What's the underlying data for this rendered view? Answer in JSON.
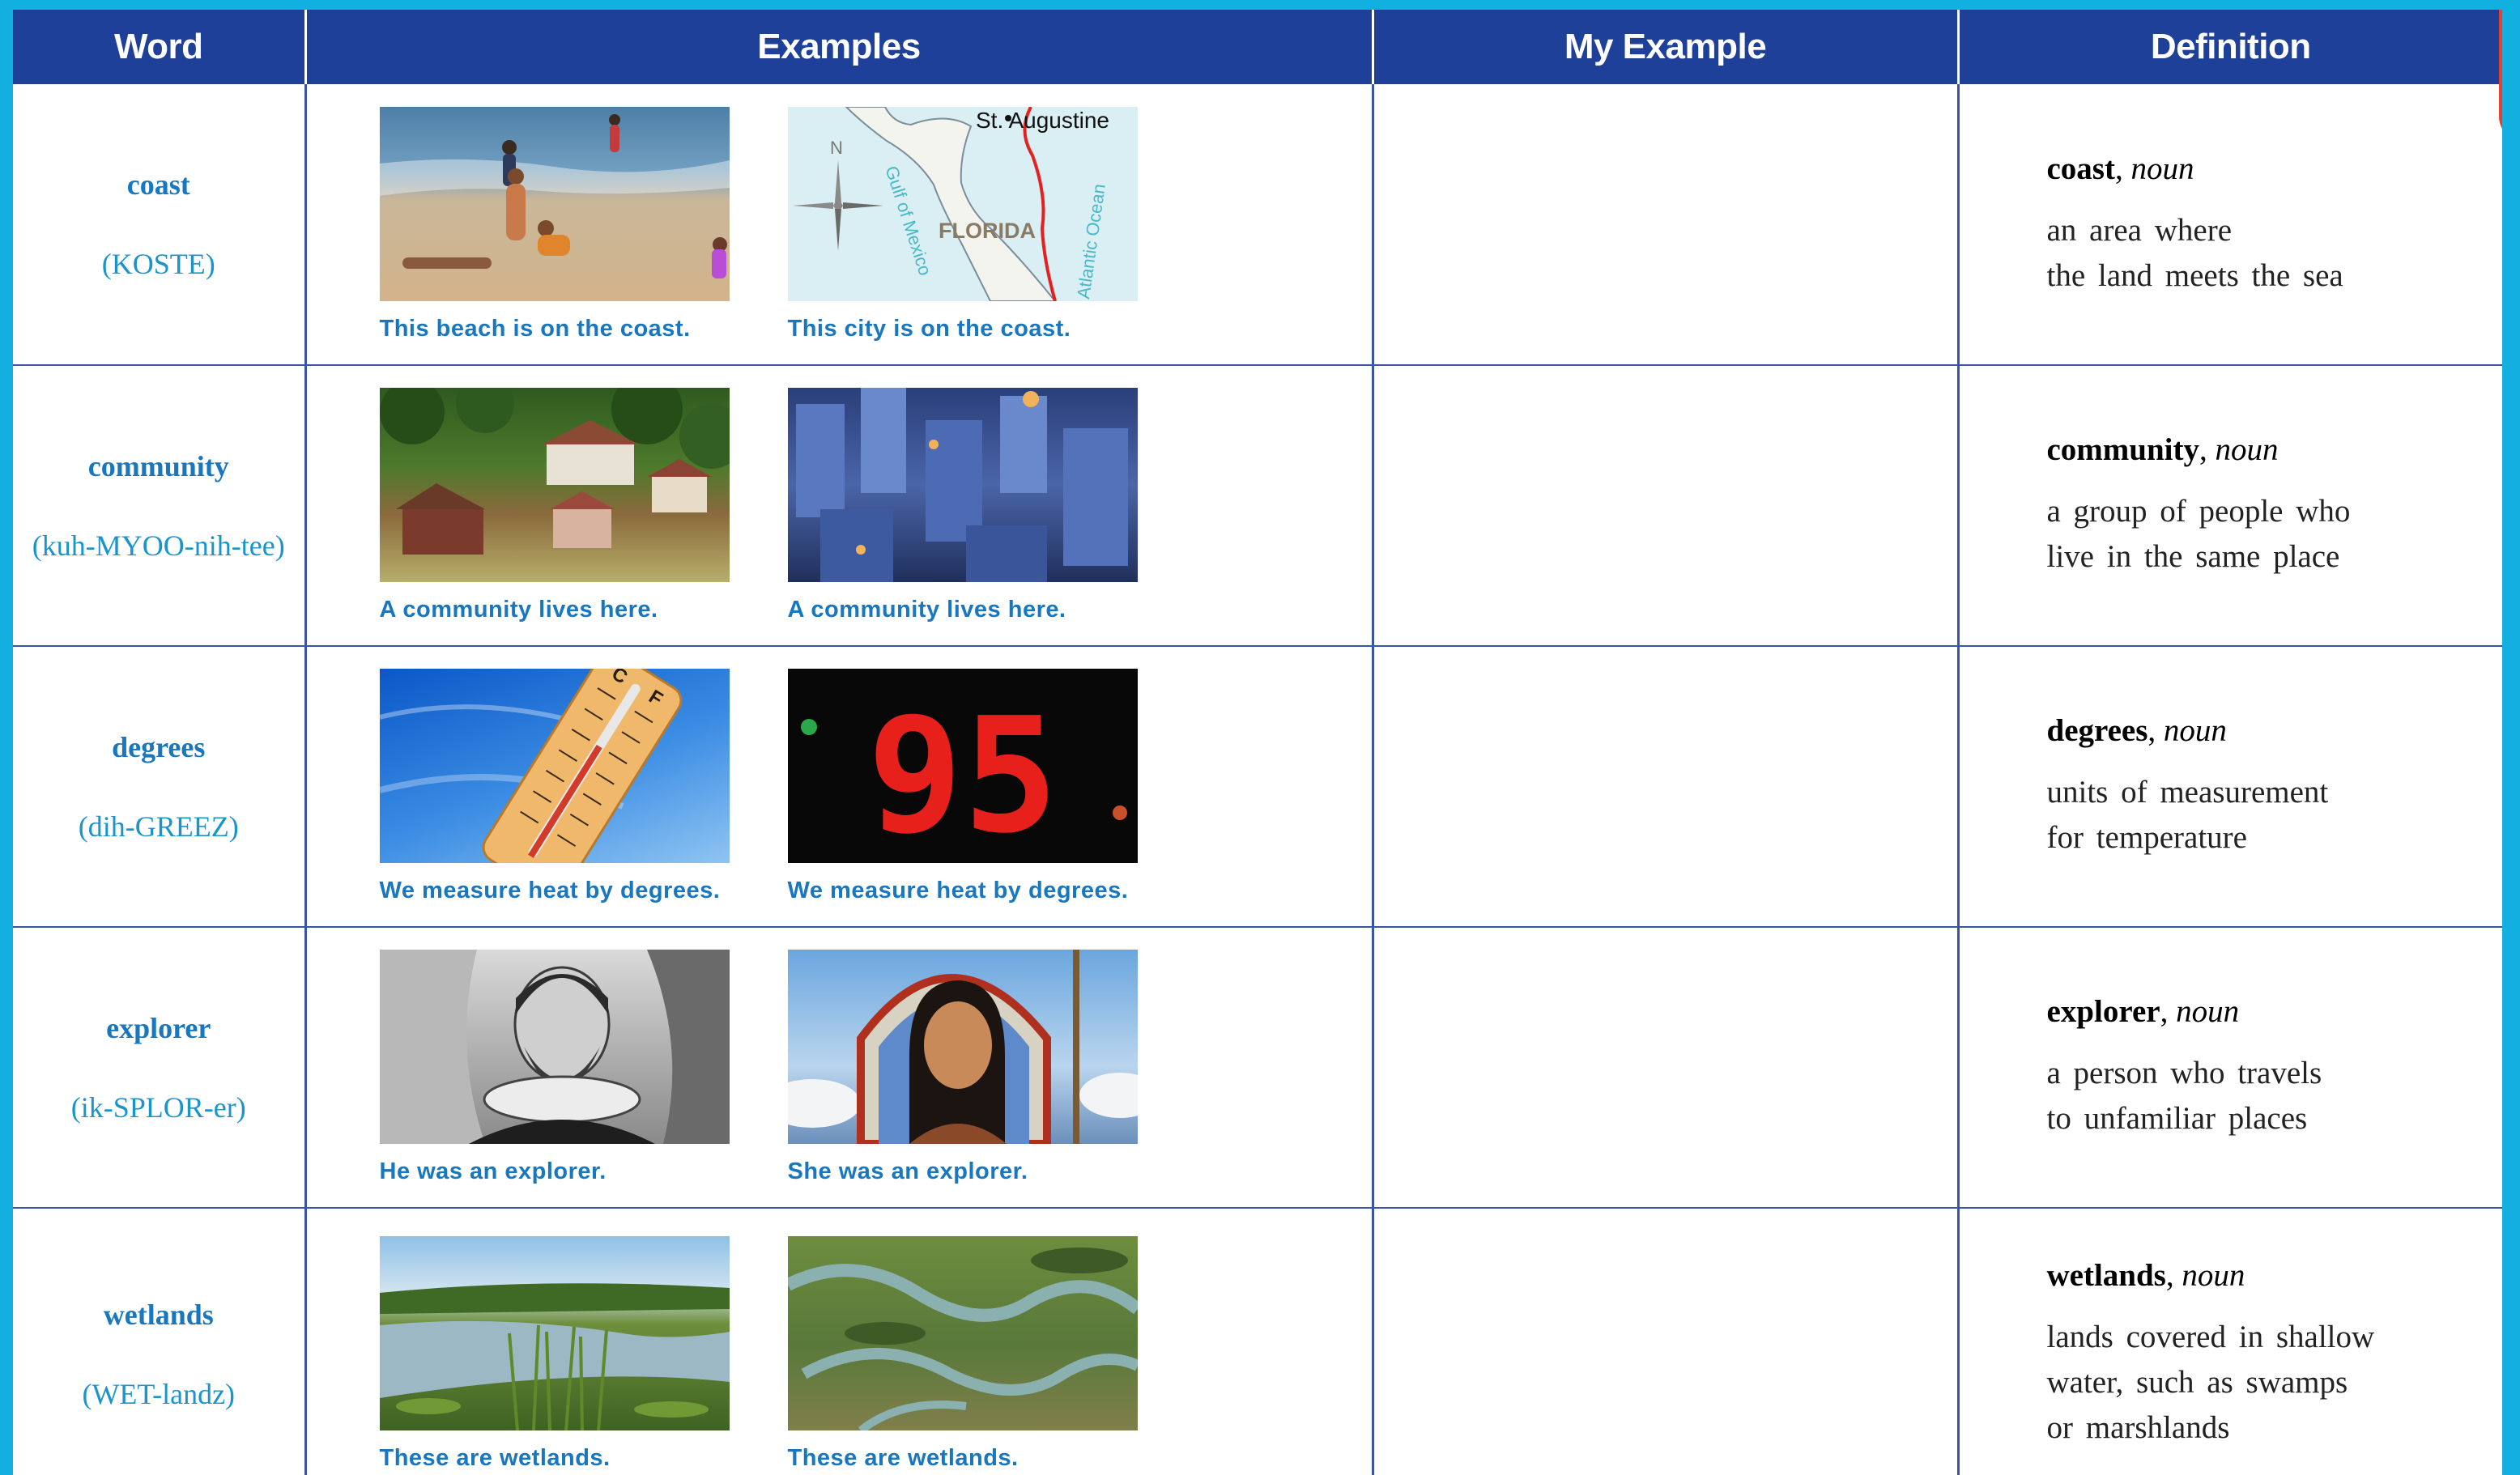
{
  "header": {
    "word": "Word",
    "examples": "Examples",
    "my_example": "My Example",
    "definition": "Definition"
  },
  "colors": {
    "header_bg": "#1e4098",
    "accent_blue": "#1877be",
    "frame": "#12b0e0",
    "tab": "#e8412f"
  },
  "rows": [
    {
      "word": "coast",
      "pron": "(KOSTE)",
      "examples": [
        {
          "image": "beach-photo",
          "caption": "This beach is on the coast."
        },
        {
          "image": "florida-map",
          "caption": "This city is on the coast.",
          "labels": {
            "city": "St. Augustine",
            "state": "FLORIDA",
            "gulf": "Gulf of Mexico",
            "ocean": "Atlantic Ocean",
            "compass": "N"
          }
        }
      ],
      "my_example": "",
      "definition": {
        "term": "coast",
        "pos": "noun",
        "lines": [
          "an area where",
          "the land meets the sea"
        ]
      }
    },
    {
      "word": "community",
      "pron": "(kuh-MYOO-nih-tee)",
      "examples": [
        {
          "image": "village-photo",
          "caption": "A community lives here."
        },
        {
          "image": "city-photo",
          "caption": "A community lives here."
        }
      ],
      "my_example": "",
      "definition": {
        "term": "community",
        "pos": "noun",
        "lines": [
          "a group of people who",
          "live in the same place"
        ]
      }
    },
    {
      "word": "degrees",
      "pron": "(dih-GREEZ)",
      "examples": [
        {
          "image": "thermometer-photo",
          "caption": "We measure heat by degrees.",
          "labels": {
            "c": "C",
            "f": "F"
          }
        },
        {
          "image": "led-display-photo",
          "caption": "We measure heat by degrees.",
          "labels": {
            "reading": "95"
          }
        }
      ],
      "my_example": "",
      "definition": {
        "term": "degrees",
        "pos": "noun",
        "lines": [
          "units of measurement",
          "for temperature"
        ]
      }
    },
    {
      "word": "explorer",
      "pron": "(ik-SPLOR-er)",
      "examples": [
        {
          "image": "explorer-engraving",
          "caption": "He was an explorer."
        },
        {
          "image": "explorer-painting",
          "caption": "She was an explorer."
        }
      ],
      "my_example": "",
      "definition": {
        "term": "explorer",
        "pos": "noun",
        "lines": [
          "a person who travels",
          "to unfamiliar places"
        ]
      }
    },
    {
      "word": "wetlands",
      "pron": "(WET-landz)",
      "examples": [
        {
          "image": "marsh-photo",
          "caption": "These are wetlands."
        },
        {
          "image": "aerial-wetland-photo",
          "caption": "These are wetlands."
        }
      ],
      "my_example": "",
      "definition": {
        "term": "wetlands",
        "pos": "noun",
        "lines": [
          "lands covered in shallow",
          "water, such as swamps",
          "or marshlands"
        ]
      }
    }
  ]
}
